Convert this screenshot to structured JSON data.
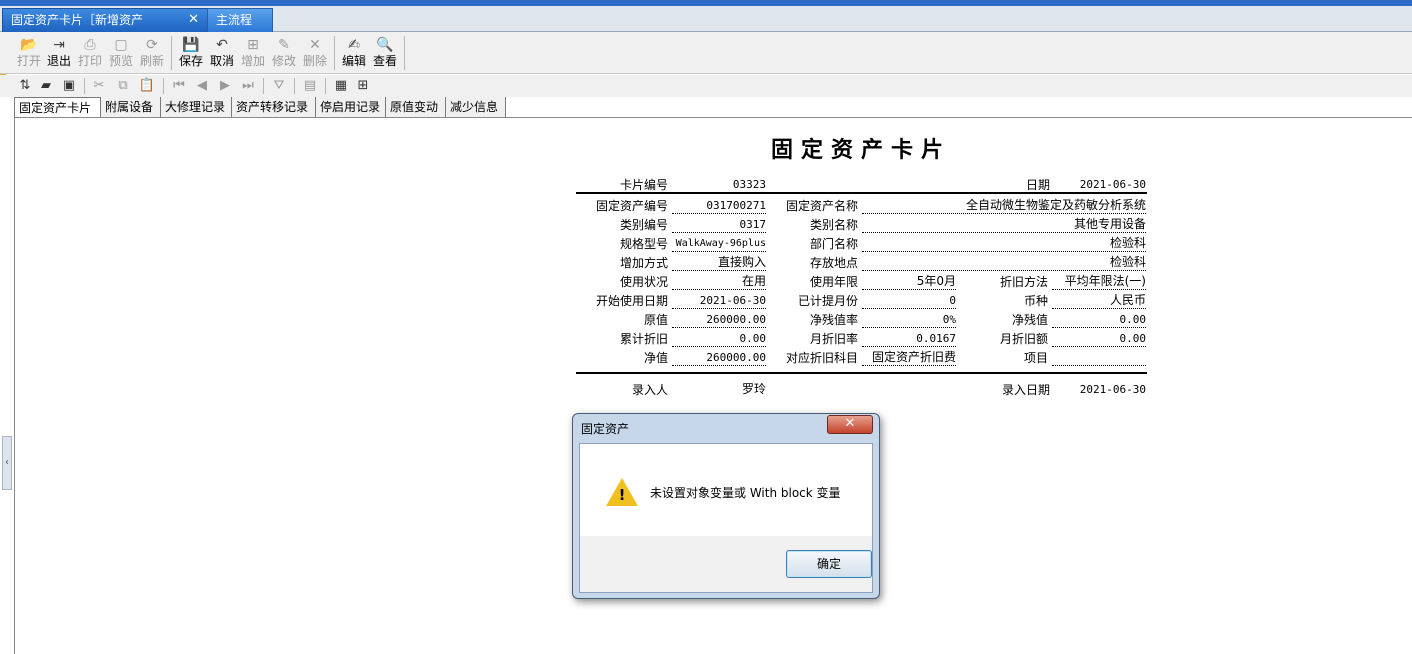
{
  "doc_tabs": {
    "active_label": "固定资产卡片［新增资产",
    "inactive_label": "主流程"
  },
  "toolbar": {
    "open": "打开",
    "exit": "退出",
    "print": "打印",
    "preview": "预览",
    "refresh": "刷新",
    "save": "保存",
    "cancel": "取消",
    "add": "增加",
    "modify": "修改",
    "delete": "删除",
    "edit": "编辑",
    "view": "查看"
  },
  "sub_tabs": [
    "固定资产卡片",
    "附属设备",
    "大修理记录",
    "资产转移记录",
    "停启用记录",
    "原值变动",
    "减少信息"
  ],
  "card": {
    "title": "固定资产卡片",
    "card_no_label": "卡片编号",
    "card_no": "03323",
    "date_label": "日期",
    "date": "2021-06-30",
    "asset_no_label": "固定资产编号",
    "asset_no": "031700271",
    "asset_name_label": "固定资产名称",
    "asset_name": "全自动微生物鉴定及药敏分析系统",
    "category_no_label": "类别编号",
    "category_no": "0317",
    "category_name_label": "类别名称",
    "category_name": "其他专用设备",
    "model_label": "规格型号",
    "model": "WalkAway-96plus",
    "dept_label": "部门名称",
    "dept": "检验科",
    "add_method_label": "增加方式",
    "add_method": "直接购入",
    "location_label": "存放地点",
    "location": "检验科",
    "status_label": "使用状况",
    "status": "在用",
    "life_label": "使用年限",
    "life": "5年0月",
    "dep_method_label": "折旧方法",
    "dep_method": "平均年限法(一)",
    "start_date_label": "开始使用日期",
    "start_date": "2021-06-30",
    "months_label": "已计提月份",
    "months": "0",
    "currency_label": "币种",
    "currency": "人民币",
    "orig_value_label": "原值",
    "orig_value": "260000.00",
    "residual_rate_label": "净残值率",
    "residual_rate": "0%",
    "residual_label": "净残值",
    "residual": "0.00",
    "acc_dep_label": "累计折旧",
    "acc_dep": "0.00",
    "monthly_rate_label": "月折旧率",
    "monthly_rate": "0.0167",
    "monthly_amt_label": "月折旧额",
    "monthly_amt": "0.00",
    "net_value_label": "净值",
    "net_value": "260000.00",
    "dep_account_label": "对应折旧科目",
    "dep_account": "固定资产折旧费",
    "item_label": "项目",
    "item": "",
    "entered_by_label": "录入人",
    "entered_by": "罗玲",
    "entry_date_label": "录入日期",
    "entry_date": "2021-06-30"
  },
  "dialog": {
    "title": "固定资产",
    "message": "未设置对象变量或 With block 变量",
    "ok": "确定",
    "close": "✕"
  }
}
